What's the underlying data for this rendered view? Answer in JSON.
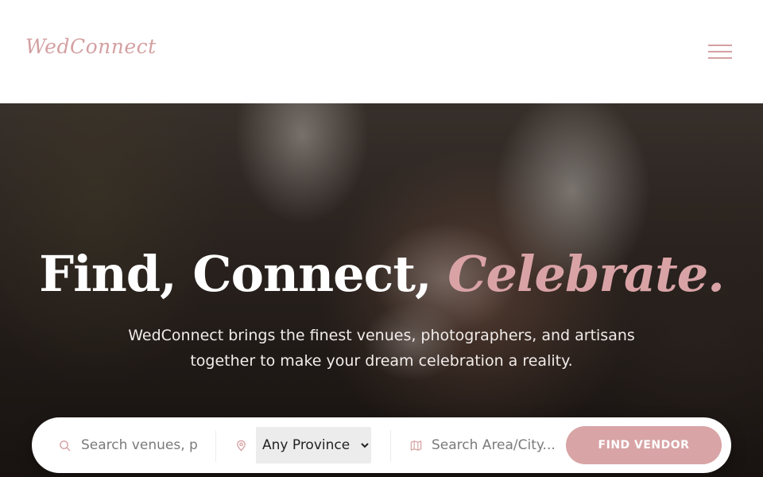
{
  "header": {
    "logo_text": "WedConnect",
    "menu_icon": "hamburger-menu-icon"
  },
  "hero": {
    "headline_main": "Find, Connect,",
    "headline_accent": "Celebrate.",
    "subtext": "WedConnect brings the finest venues, photographers, and artisans together to make your dream celebration a reality."
  },
  "search": {
    "keyword_placeholder": "Search venues, photographers...",
    "province_selected": "Any Province",
    "area_placeholder": "Search Area/City...",
    "button_label": "FIND VENDOR",
    "icons": [
      "search-icon",
      "map-pin-icon",
      "map-icon"
    ]
  },
  "colors": {
    "accent": "#d8a4a6",
    "white": "#ffffff"
  }
}
